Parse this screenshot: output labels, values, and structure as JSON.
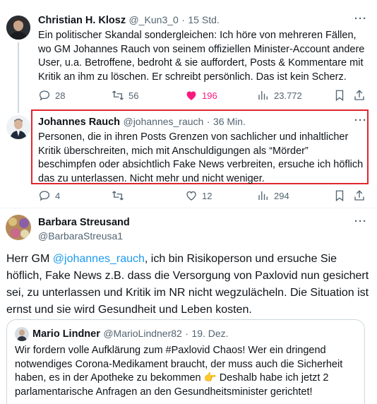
{
  "tweets": [
    {
      "name": "Christian H. Klosz",
      "handle": "@_Kun3_0",
      "time": "15 Std.",
      "text": "Ein politischer Skandal sondergleichen: Ich höre von mehreren Fällen, wo GM Johannes Rauch von seinem offiziellen Minister-Account andere User, u.a. Betroffene, bedroht & sie auffordert, Posts & Kommentare mit Kritik an ihm zu löschen. Er schreibt persönlich. Das ist kein Scherz.",
      "more": "···",
      "replies": "28",
      "reposts": "56",
      "likes": "196",
      "views": "23.772"
    },
    {
      "name": "Johannes Rauch",
      "handle": "@johannes_rauch",
      "time": "36 Min.",
      "text": "Personen, die in ihren Posts Grenzen von sachlicher und inhaltlicher Kritik überschreiten, mich mit Anschuldigungen als “Mörder” beschimpfen oder absichtlich Fake News verbreiten, ersuche ich höflich das zu unterlassen. Nicht mehr und nicht weniger.",
      "more": "···",
      "replies": "4",
      "reposts": "",
      "likes": "12",
      "views": "294"
    }
  ],
  "reply": {
    "name": "Barbara Streusand",
    "handle": "@BarbaraStreusa1",
    "more": "···",
    "text_before": "Herr GM ",
    "mention": "@johannes_rauch",
    "text_after": ", ich bin Risikoperson und ersuche Sie höflich, Fake News z.B. dass die Versorgung von Paxlovid nun gesichert sei, zu unterlassen und Kritik im NR nicht wegzulächeln. Die Situation ist ernst und sie wird Gesundheit und Leben kosten."
  },
  "quote": {
    "name": "Mario Lindner",
    "handle": "@MarioLindner82",
    "time": "19. Dez.",
    "text": "Wir fordern volle Aufklärung zum #Paxlovid Chaos! Wer ein dringend notwendiges Corona-Medikament braucht, der muss auch die Sicherheit haben, es in der Apotheke zu bekommen 👉 Deshalb habe ich jetzt 2 parlamentarische Anfragen an den Gesundheitsminister gerichtet!"
  },
  "colors": {
    "like_active": "#f91880",
    "highlight_border": "#e0262e",
    "link": "#1d9bf0",
    "secondary_text": "#536471"
  },
  "icons": [
    "reply-icon",
    "repost-icon",
    "heart-icon",
    "views-icon",
    "bookmark-icon",
    "share-icon",
    "more-icon"
  ]
}
